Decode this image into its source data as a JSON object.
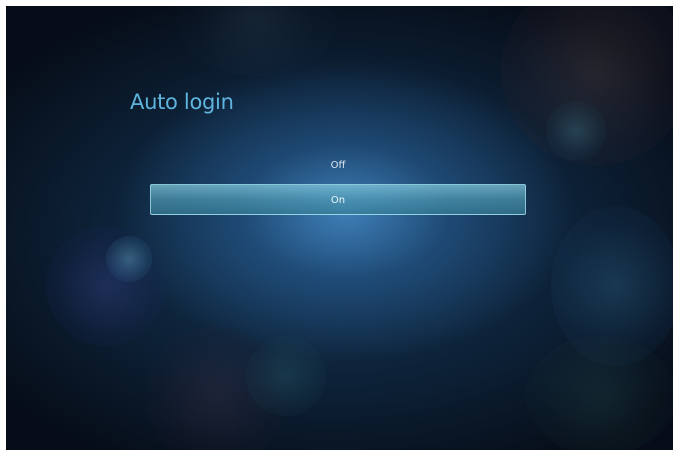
{
  "screen": {
    "title": "Auto login"
  },
  "options": [
    {
      "label": "Off",
      "selected": false
    },
    {
      "label": "On",
      "selected": true
    }
  ],
  "colors": {
    "title": "#5fb4de",
    "highlight": "#6fb8cf",
    "background": "#0d2238"
  }
}
